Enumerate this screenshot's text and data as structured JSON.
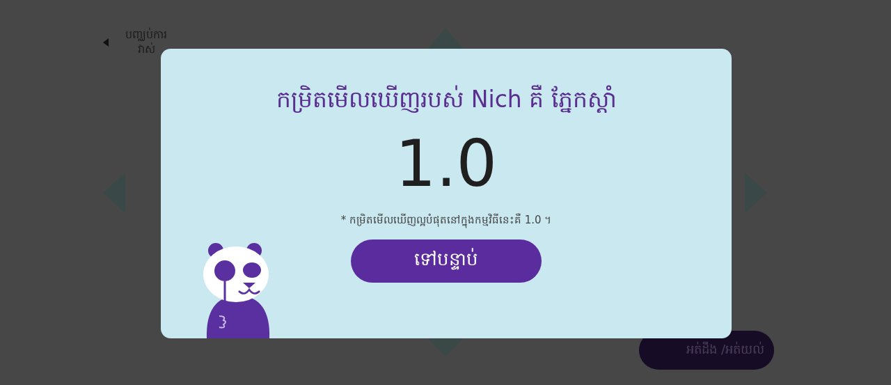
{
  "back_link": {
    "label": "បញ្ឈប់ការវាស់"
  },
  "background_button": {
    "label": "អត់ដឹង /អត់យល់"
  },
  "dialog": {
    "title": "កម្រិតមើលឃើញរបស់ Nich គឺ ភ្នែកស្តាំ",
    "score": "1.0",
    "note": "* កម្រិតមើលឃើញល្អបំផុតនៅក្នុងកម្មវិធីនេះគឺ 1.0 ។",
    "next_button": "ទៅបន្ទាប់"
  }
}
